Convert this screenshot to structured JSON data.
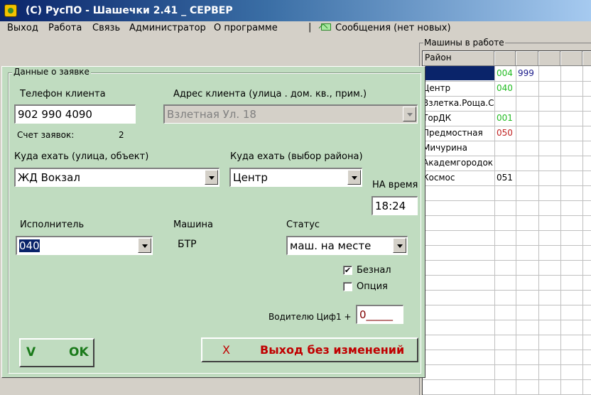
{
  "window": {
    "title": "(C) РусПО - Шашечки 2.41 _ СЕРВЕР"
  },
  "menu": {
    "items": [
      "Выход",
      "Работа",
      "Связь",
      "Администратор",
      "О программе"
    ],
    "separator": "|",
    "messages": "Сообщения (нет новых)"
  },
  "machines": {
    "legend": "Машины в работе",
    "header": "Район",
    "rows": [
      {
        "district": "",
        "c1": "004",
        "c1_color": "#22bb22",
        "c2": "999",
        "c2_color": "#1a1a8a"
      },
      {
        "district": "Центр",
        "c1": "040",
        "c1_color": "#22bb22",
        "c2": ""
      },
      {
        "district": "Взлетка.Роща.С",
        "c1": "",
        "c2": ""
      },
      {
        "district": "ТорДК",
        "c1": "001",
        "c1_color": "#22bb22",
        "c2": ""
      },
      {
        "district": "Предмостная",
        "c1": "050",
        "c1_color": "#c02020",
        "c2": ""
      },
      {
        "district": "Мичурина",
        "c1": "",
        "c2": ""
      },
      {
        "district": "Академгородок",
        "c1": "",
        "c2": ""
      },
      {
        "district": "Космос",
        "c1": "051",
        "c1_color": "#000000",
        "c2": ""
      }
    ]
  },
  "dialog": {
    "legend": "Данные о заявке",
    "phone_label": "Телефон клиента",
    "phone_value": "902 990 4090",
    "address_label": "Адрес клиента (улица . дом. кв., прим.)",
    "address_value": "Взлетная Ул. 18",
    "orders_count_label": "Счет заявок:",
    "orders_count_value": "2",
    "destination_label": "Куда ехать (улица, объект)",
    "destination_value": "ЖД Вокзал",
    "district_label": "Куда ехать (выбор района)",
    "district_value": "Центр",
    "time_label": "НА время",
    "time_value": "18:24",
    "executor_label": "Исполнитель",
    "executor_value": "040",
    "car_label": "Машина",
    "car_value": "БТР",
    "status_label": "Статус",
    "status_value": "маш. на месте",
    "cashless_label": "Безнал",
    "cashless_checked": true,
    "option_label": "Опция",
    "option_checked": false,
    "driver_digit_label": "Водителю Циф1 +",
    "driver_digit_value": "0_____",
    "ok_check": "V",
    "ok_label": "OK",
    "cancel_x": "X",
    "cancel_label": "Выход без изменений"
  }
}
